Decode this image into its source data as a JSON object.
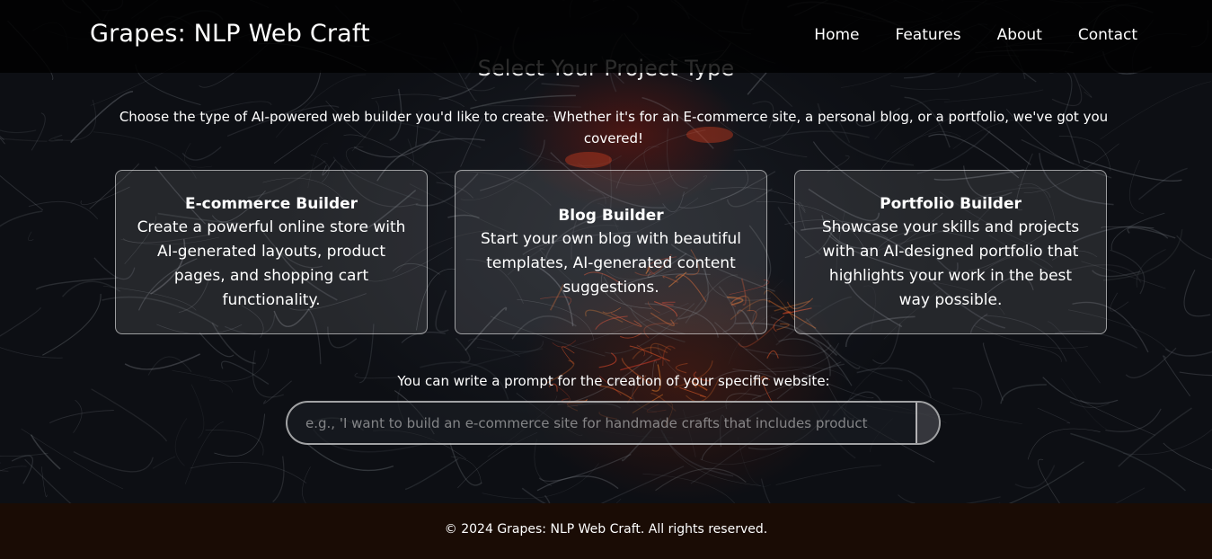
{
  "header": {
    "brand": "Grapes: NLP Web Craft",
    "nav": [
      "Home",
      "Features",
      "About",
      "Contact"
    ]
  },
  "main": {
    "section_title": "Select Your Project Type",
    "intro": "Choose the type of AI-powered web builder you'd like to create. Whether it's for an E-commerce site, a personal blog, or a portfolio, we've got you covered!",
    "cards": [
      {
        "title": "E-commerce Builder",
        "description": "Create a powerful online store with AI-generated layouts, product pages, and shopping cart functionality."
      },
      {
        "title": "Blog Builder",
        "description": "Start your own blog with beautiful templates, AI-generated content suggestions."
      },
      {
        "title": "Portfolio Builder",
        "description": "Showcase your skills and projects with an AI-designed portfolio that highlights your work in the best way possible."
      }
    ],
    "prompt": {
      "label": "You can write a prompt for the creation of your specific website:",
      "placeholder": "e.g., 'I want to build an e-commerce site for handmade crafts that includes product",
      "value": ""
    }
  },
  "footer": {
    "text": "© 2024 Grapes: NLP Web Craft. All rights reserved."
  },
  "colors": {
    "header_bg": "#000000",
    "footer_bg": "#1a0c05",
    "text": "#ffffff",
    "accent_glow": "#c0392b"
  }
}
